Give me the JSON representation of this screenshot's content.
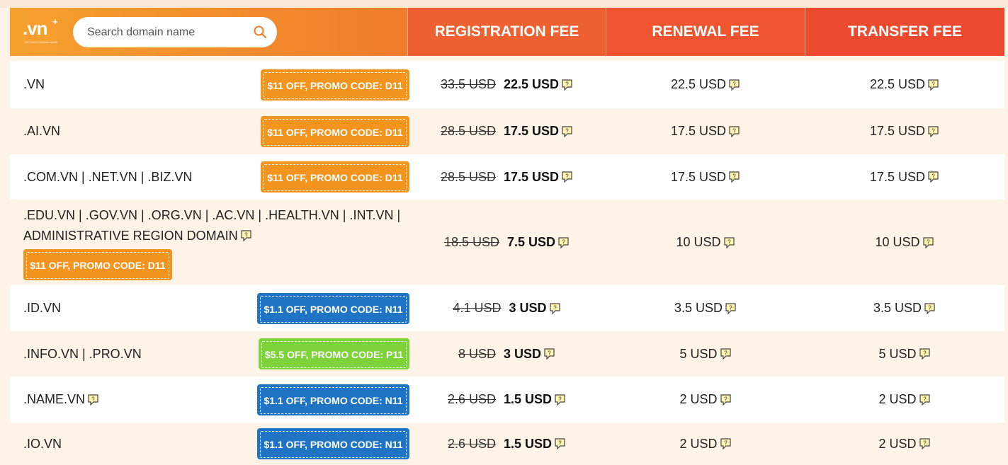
{
  "header": {
    "logo_text": ".vn",
    "logo_plus": "+",
    "logo_tagline": "VIETNAM DOMAIN NAME",
    "search_placeholder": "Search domain name",
    "col_registration": "REGISTRATION FEE",
    "col_renewal": "RENEWAL FEE",
    "col_transfer": "TRANSFER FEE"
  },
  "rows": [
    {
      "domain": ".VN",
      "promo": "$11 OFF, PROMO CODE: D11",
      "promo_color": "#f3941e",
      "old_price": "33.5 USD",
      "new_price": "22.5 USD",
      "renewal": "22.5 USD",
      "transfer": "22.5 USD"
    },
    {
      "domain": ".AI.VN",
      "promo": "$11 OFF, PROMO CODE: D11",
      "promo_color": "#f3941e",
      "old_price": "28.5 USD",
      "new_price": "17.5 USD",
      "renewal": "17.5 USD",
      "transfer": "17.5 USD"
    },
    {
      "domain": ".COM.VN | .NET.VN | .BIZ.VN",
      "promo": "$11 OFF, PROMO CODE: D11",
      "promo_color": "#f3941e",
      "old_price": "28.5 USD",
      "new_price": "17.5 USD",
      "renewal": "17.5 USD",
      "transfer": "17.5 USD"
    },
    {
      "domain_line1": ".EDU.VN | .GOV.VN | .ORG.VN | .AC.VN | .HEALTH.VN | .INT.VN |",
      "domain_line2": "ADMINISTRATIVE REGION DOMAIN",
      "promo": "$11 OFF, PROMO CODE: D11",
      "promo_color": "#f3941e",
      "old_price": "18.5 USD",
      "new_price": "7.5 USD",
      "renewal": "10 USD",
      "transfer": "10 USD"
    },
    {
      "domain": ".ID.VN",
      "promo": "$1.1 OFF, PROMO CODE: N11",
      "promo_color": "#1f75c4",
      "old_price": "4.1 USD",
      "new_price": "3 USD",
      "renewal": "3.5 USD",
      "transfer": "3.5 USD"
    },
    {
      "domain": ".INFO.VN | .PRO.VN",
      "promo": "$5.5 OFF, PROMO CODE: P11",
      "promo_color": "#7ed23a",
      "old_price": "8 USD",
      "new_price": "3 USD",
      "renewal": "5 USD",
      "transfer": "5 USD"
    },
    {
      "domain": ".NAME.VN",
      "promo": "$1.1 OFF, PROMO CODE: N11",
      "promo_color": "#1f75c4",
      "old_price": "2.6 USD",
      "new_price": "1.5 USD",
      "renewal": "2 USD",
      "transfer": "2 USD"
    },
    {
      "domain": ".IO.VN",
      "promo": "$1.1 OFF, PROMO CODE: N11",
      "promo_color": "#1f75c4",
      "old_price": "2.6 USD",
      "new_price": "1.5 USD",
      "renewal": "2 USD",
      "transfer": "2 USD"
    }
  ],
  "icons": {
    "search": "search-icon",
    "info": "question-note-icon"
  }
}
